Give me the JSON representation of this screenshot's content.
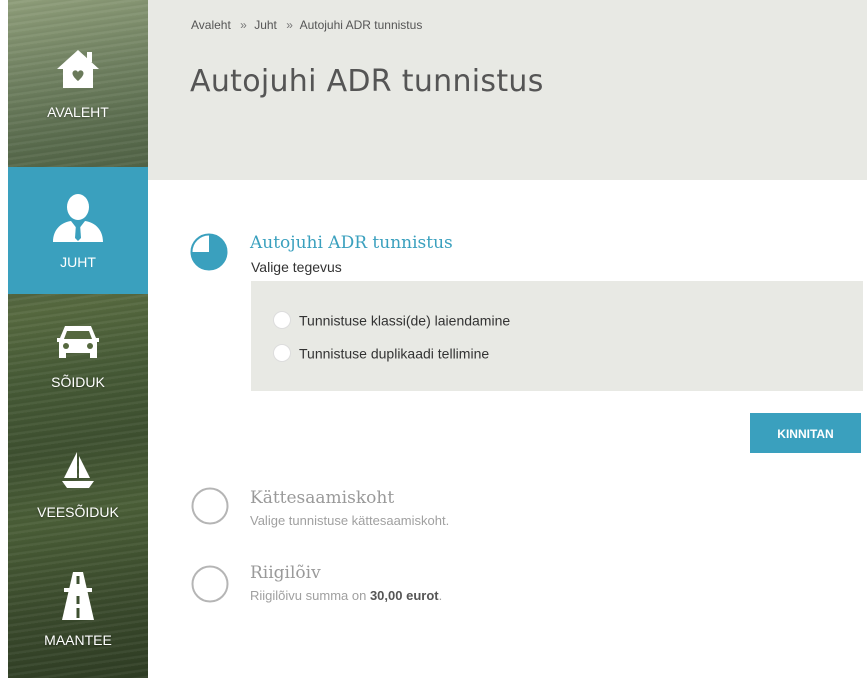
{
  "sidebar": {
    "items": [
      {
        "label": "AVALEHT",
        "icon": "home-icon"
      },
      {
        "label": "JUHT",
        "icon": "person-icon",
        "active": true
      },
      {
        "label": "SÕIDUK",
        "icon": "car-icon"
      },
      {
        "label": "VEESÕIDUK",
        "icon": "sailboat-icon"
      },
      {
        "label": "MAANTEE",
        "icon": "road-icon"
      }
    ]
  },
  "breadcrumb": {
    "items": [
      "Avaleht",
      "Juht",
      "Autojuhi ADR tunnistus"
    ],
    "separator": "»"
  },
  "page_title": "Autojuhi ADR tunnistus",
  "steps": [
    {
      "title": "Autojuhi ADR tunnistus",
      "subtitle": "Valige tegevus",
      "active": true,
      "options": [
        "Tunnistuse klassi(de) laiendamine",
        "Tunnistuse duplikaadi tellimine"
      ],
      "confirm_label": "KINNITAN"
    },
    {
      "title": "Kättesaamiskoht",
      "subtitle": "Valige tunnistuse kättesaamiskoht.",
      "active": false
    },
    {
      "title": "Riigilõiv",
      "subtitle_prefix": "Riigilõivu summa on",
      "amount": "30,00 eurot",
      "subtitle_suffix": ".",
      "active": false
    }
  ],
  "colors": {
    "accent": "#3aa0be",
    "header_bg": "#e8e9e4",
    "inactive_text": "#9a9a9a"
  }
}
